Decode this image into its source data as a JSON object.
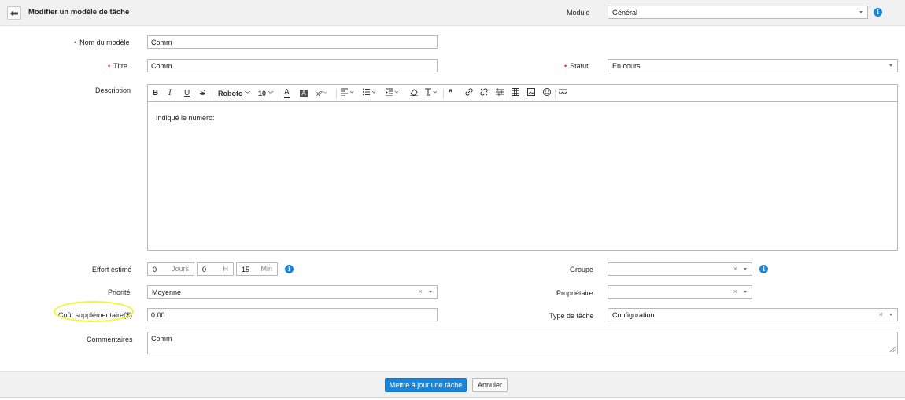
{
  "header": {
    "title": "Modifier un modèle de tâche",
    "module_label": "Module",
    "module_value": "Général"
  },
  "form": {
    "nom_label": "Nom du modèle",
    "nom_value": "Comm",
    "titre_label": "Titre",
    "titre_value": "Comm",
    "statut_label": "Statut",
    "statut_value": "En cours",
    "description_label": "Description",
    "description_text": "Indiqué le numéro:",
    "effort_label": "Effort estimé",
    "effort_jours": "0",
    "effort_jours_unit": "Jours",
    "effort_heures": "0",
    "effort_heures_unit": "H",
    "effort_minutes": "15",
    "effort_minutes_unit": "Min",
    "groupe_label": "Groupe",
    "groupe_value": "",
    "priorite_label": "Priorité",
    "priorite_value": "Moyenne",
    "proprietaire_label": "Propriétaire",
    "proprietaire_value": "",
    "cout_label": "Coût supplémentaire($)",
    "cout_value": "0.00",
    "type_label": "Type de tâche",
    "type_value": "Configuration",
    "commentaires_label": "Commentaires",
    "commentaires_value": "Comm -"
  },
  "toolbar": {
    "bold": "B",
    "italic": "I",
    "underline": "U",
    "strike": "S",
    "font": "Roboto",
    "size": "10",
    "font_color": "A",
    "bg_color": "A",
    "superscript": "x²"
  },
  "footer": {
    "update_label": "Mettre à jour une tâche",
    "cancel_label": "Annuler"
  },
  "colors": {
    "accent": "#1a86d9",
    "required": "#e02020",
    "highlight": "#f4f436"
  }
}
